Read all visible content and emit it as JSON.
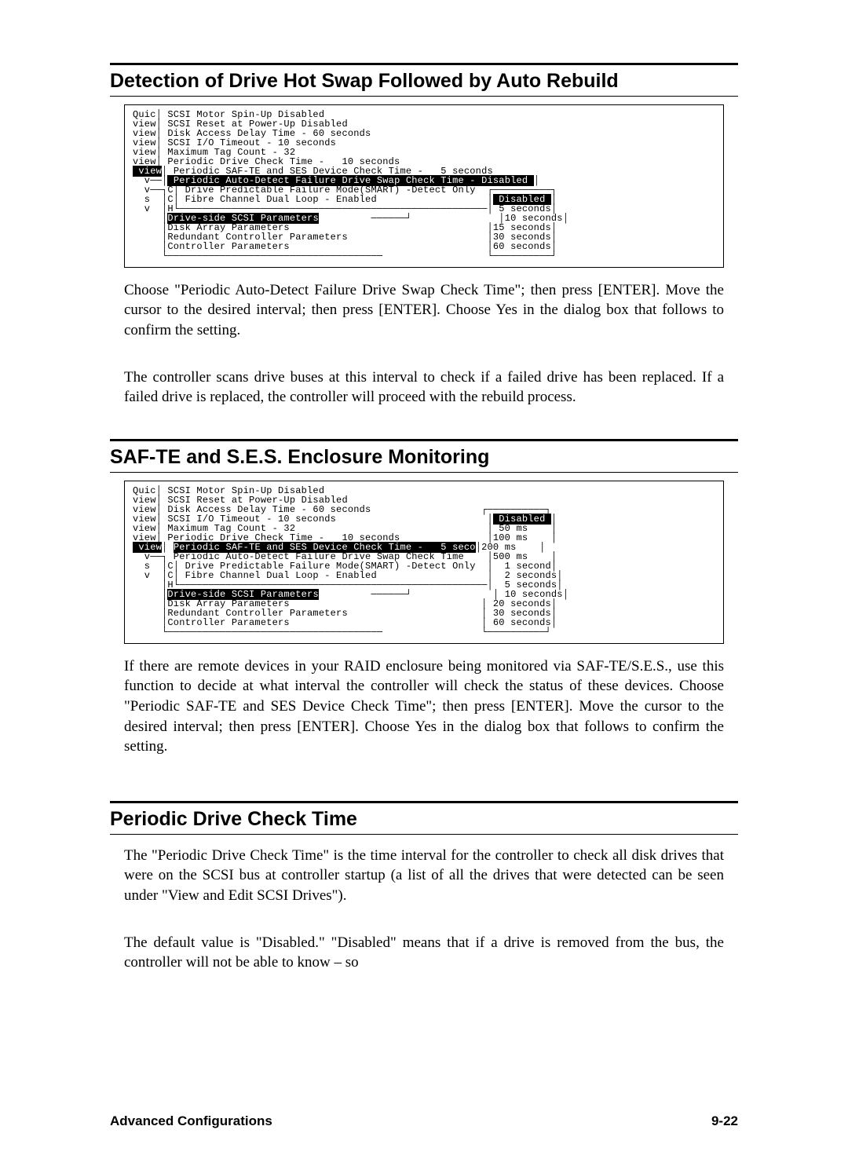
{
  "sections": {
    "s1": {
      "title": "Detection of Drive Hot Swap Followed by Auto Rebuild",
      "terminal": "Quic│ SCSI Motor Spin-Up Disabled\nview│ SCSI Reset at Power-Up Disabled\nview│ Disk Access Delay Time - 60 seconds\nview│ SCSI I/O Timeout - 10 seconds\nview│ Maximum Tag Count - 32\nview│ Periodic Drive Check Time -   10 seconds\n",
      "terminal_hl1_left": " view",
      "terminal_hl1_mid": "│ Periodic SAF-TE and SES Device Check Time -   5 seconds",
      "terminal_hl2": " Periodic Auto-Detect Failure Drive Swap Check Time - Disabled ",
      "terminal_after": "  v──┐C│ Drive Predictable Failure Mode(SMART) -Detect Only  ┌──────────┐\n  s  │C│ Fibre Channel Dual Loop - Enabled                   │",
      "menu_sel": " Disabled ",
      "terminal_menu": "│\n  v  │H└─────────────────────────────────────────────────────│ 5 seconds│\n     │",
      "menu_hl": "Drive-side SCSI Parameters",
      "terminal_menu2": "         ──────┘               │10 seconds│\n     │Disk Array Parameters                                  │15 seconds│\n     │Redundant Controller Parameters                        │30 seconds│\n     │Controller Parameters                                  │60 seconds│\n     └─────────────────────────────────────                  └──────────┘",
      "para1": "Choose \"Periodic Auto-Detect Failure Drive Swap Check Time\"; then press [ENTER].  Move the cursor to the desired interval; then press [ENTER].  Choose Yes in the dialog box that follows to confirm the setting.",
      "para2": "The controller scans drive buses at this interval to check if a failed drive has been replaced.  If a failed drive is replaced, the controller will proceed with the rebuild process."
    },
    "s2": {
      "title": "SAF-TE and S.E.S. Enclosure Monitoring",
      "terminal": "Quic│ SCSI Motor Spin-Up Disabled\nview│ SCSI Reset at Power-Up Disabled\nview│ Disk Access Delay Time - 60 seconds                   ┌──────────┐\nview│ SCSI I/O Timeout - 10 seconds                          │",
      "menu_sel": " Disabled ",
      "terminal2": "│\nview│ Maximum Tag Count - 32                                 │ 50 ms    │\nview│ Periodic Drive Check Time -   10 seconds               │100 ms    │\n",
      "hl_left": " view",
      "hl_mid": "│ ",
      "hl_row": "Periodic SAF-TE and SES Device Check Time -   5 seco",
      "terminal3": "│200 ms    │\n  v──┐ Periodic Auto-Detect Failure Drive Swap Check Time    │500 ms    │\n  s  │C│ Drive Predictable Failure Mode(SMART) -Detect Only  │  1 second│\n  v  │C│ Fibre Channel Dual Loop - Enabled                   │  2 seconds│\n     │H└─────────────────────────────────────────────────────│  5 seconds│\n     │",
      "menu_hl": "Drive-side SCSI Parameters",
      "terminal4": "         ──────┘              │ 10 seconds│\n     │Disk Array Parameters                                 │ 20 seconds│\n     │Redundant Controller Parameters                       │ 30 seconds│\n     │Controller Parameters                                 │ 60 seconds│\n     └─────────────────────────────────────                 └──────────┘",
      "para1": "If there are remote devices in your RAID enclosure being monitored via SAF-TE/S.E.S., use this function to decide at what interval the controller will check the status of these devices.  Choose \"Periodic SAF-TE and SES Device Check Time\"; then press [ENTER].  Move the cursor to the desired interval; then press [ENTER].  Choose Yes in the dialog box that follows to confirm the setting."
    },
    "s3": {
      "title": "Periodic Drive Check Time",
      "para1": "The \"Periodic Drive Check Time\" is the time interval for the controller to check all disk drives that were on the SCSI bus at controller startup (a list of all the drives that were detected can be seen under \"View and Edit SCSI Drives\").",
      "para2": "The default value is \"Disabled.\"  \"Disabled\" means that if a drive is removed from the bus, the controller will not be able to know – so"
    }
  },
  "footer": {
    "left": "Advanced Configurations",
    "right": "9-22"
  }
}
